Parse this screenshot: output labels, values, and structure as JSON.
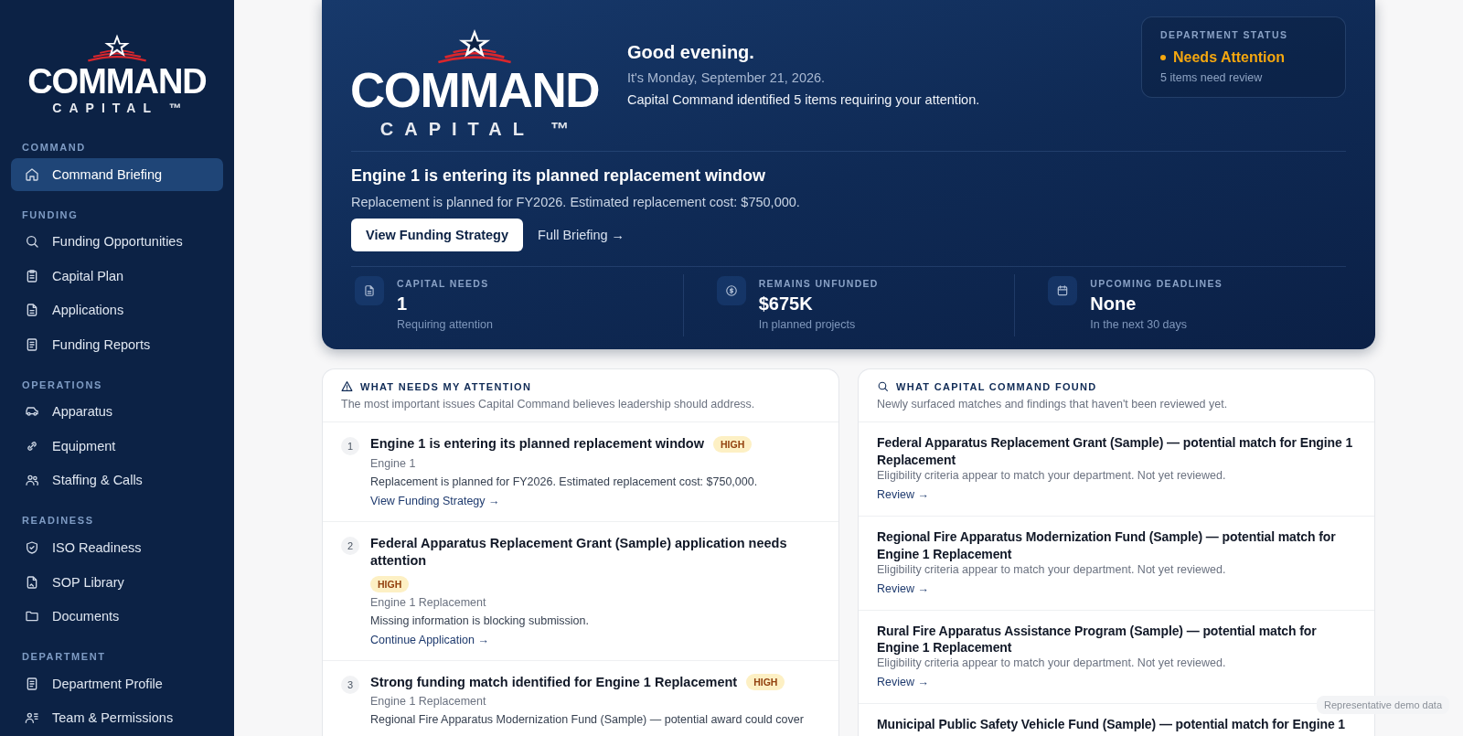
{
  "sidebar": {
    "logo": {
      "wordmark": "COMMAND",
      "subtitle": "CAPITAL ™"
    },
    "sections": [
      {
        "label": "COMMAND",
        "items": [
          {
            "label": "Command Briefing",
            "selected": true
          }
        ]
      },
      {
        "label": "FUNDING",
        "items": [
          {
            "label": "Funding Opportunities",
            "selected": false
          },
          {
            "label": "Capital Plan",
            "selected": false
          },
          {
            "label": "Applications",
            "selected": false
          },
          {
            "label": "Funding Reports",
            "selected": false
          }
        ]
      },
      {
        "label": "OPERATIONS",
        "items": [
          {
            "label": "Apparatus",
            "selected": false
          },
          {
            "label": "Equipment",
            "selected": false
          },
          {
            "label": "Staffing & Calls",
            "selected": false
          }
        ]
      },
      {
        "label": "READINESS",
        "items": [
          {
            "label": "ISO Readiness",
            "selected": false
          },
          {
            "label": "SOP Library",
            "selected": false
          },
          {
            "label": "Documents",
            "selected": false
          }
        ]
      },
      {
        "label": "DEPARTMENT",
        "items": [
          {
            "label": "Department Profile",
            "selected": false
          },
          {
            "label": "Team & Permissions",
            "selected": false
          }
        ]
      }
    ]
  },
  "hero": {
    "logo": {
      "wordmark": "COMMAND",
      "subtitle": "CAPITAL ™"
    },
    "greeting": "Good evening.",
    "date": "It's Monday, September 21, 2026.",
    "summary": "Capital Command identified 5 items requiring your attention.",
    "status": {
      "label": "DEPARTMENT STATUS",
      "value": "Needs Attention",
      "kind": "warning",
      "detail": "5 items need review"
    },
    "headline": "Engine 1 is entering its planned replacement window",
    "detail": "Replacement is planned for FY2026. Estimated replacement cost: $750,000.",
    "primary_button": "View Funding Strategy",
    "secondary_link": "Full Briefing →",
    "stats": [
      {
        "label": "CAPITAL NEEDS",
        "value": "1",
        "note": "Requiring attention"
      },
      {
        "label": "REMAINS UNFUNDED",
        "value": "$675K",
        "note": "In planned projects"
      },
      {
        "label": "UPCOMING DEADLINES",
        "value": "None",
        "note": "In the next 30 days"
      }
    ]
  },
  "attention": {
    "title": "WHAT NEEDS MY ATTENTION",
    "subtitle": "The most important issues Capital Command believes leadership should address.",
    "items": [
      {
        "number": "1",
        "title": "Engine 1 is entering its planned replacement window",
        "priority": "HIGH",
        "subject": "Engine 1",
        "detail": "Replacement is planned for FY2026. Estimated replacement cost: $750,000.",
        "action": "View Funding Strategy →"
      },
      {
        "number": "2",
        "title": "Federal Apparatus Replacement Grant (Sample) application needs attention",
        "priority": "HIGH",
        "subject": "Engine 1 Replacement",
        "detail": "Missing information is blocking submission.",
        "action": "Continue Application →"
      },
      {
        "number": "3",
        "title": "Strong funding match identified for Engine 1 Replacement",
        "priority": "HIGH",
        "subject": "Engine 1 Replacement",
        "detail": "Regional Fire Apparatus Modernization Fund (Sample) — potential award could cover"
      }
    ]
  },
  "findings": {
    "title": "WHAT CAPITAL COMMAND FOUND",
    "subtitle": "Newly surfaced matches and findings that haven't been reviewed yet.",
    "items": [
      {
        "title": "Federal Apparatus Replacement Grant (Sample) — potential match for Engine 1 Replacement",
        "detail": "Eligibility criteria appear to match your department. Not yet reviewed.",
        "action": "Review →"
      },
      {
        "title": "Regional Fire Apparatus Modernization Fund (Sample) — potential match for Engine 1 Replacement",
        "detail": "Eligibility criteria appear to match your department. Not yet reviewed.",
        "action": "Review →"
      },
      {
        "title": "Rural Fire Apparatus Assistance Program (Sample) — potential match for Engine 1 Replacement",
        "detail": "Eligibility criteria appear to match your department. Not yet reviewed.",
        "action": "Review →"
      },
      {
        "title": "Municipal Public Safety Vehicle Fund (Sample) — potential match for Engine 1"
      }
    ]
  },
  "footer_tag": "Representative demo data"
}
